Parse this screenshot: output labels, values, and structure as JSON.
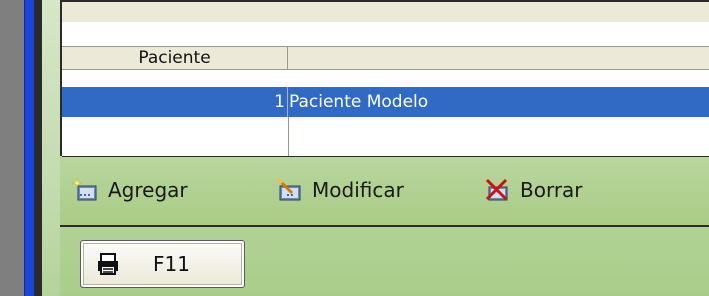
{
  "grid": {
    "column_header": "Paciente",
    "rows": [
      {
        "number": "1",
        "name": "Paciente Modelo"
      }
    ]
  },
  "toolbar": {
    "add_label": "Agregar",
    "edit_label": "Modificar",
    "delete_label": "Borrar"
  },
  "footer": {
    "print_button_label": "F11"
  },
  "icons": {
    "add": "add-record-icon",
    "edit": "edit-record-icon",
    "delete": "delete-record-icon",
    "print": "printer-icon"
  },
  "colors": {
    "selection": "#316ac5",
    "accent_blue": "#1b45d8",
    "panel_green": "#a9cc86"
  }
}
